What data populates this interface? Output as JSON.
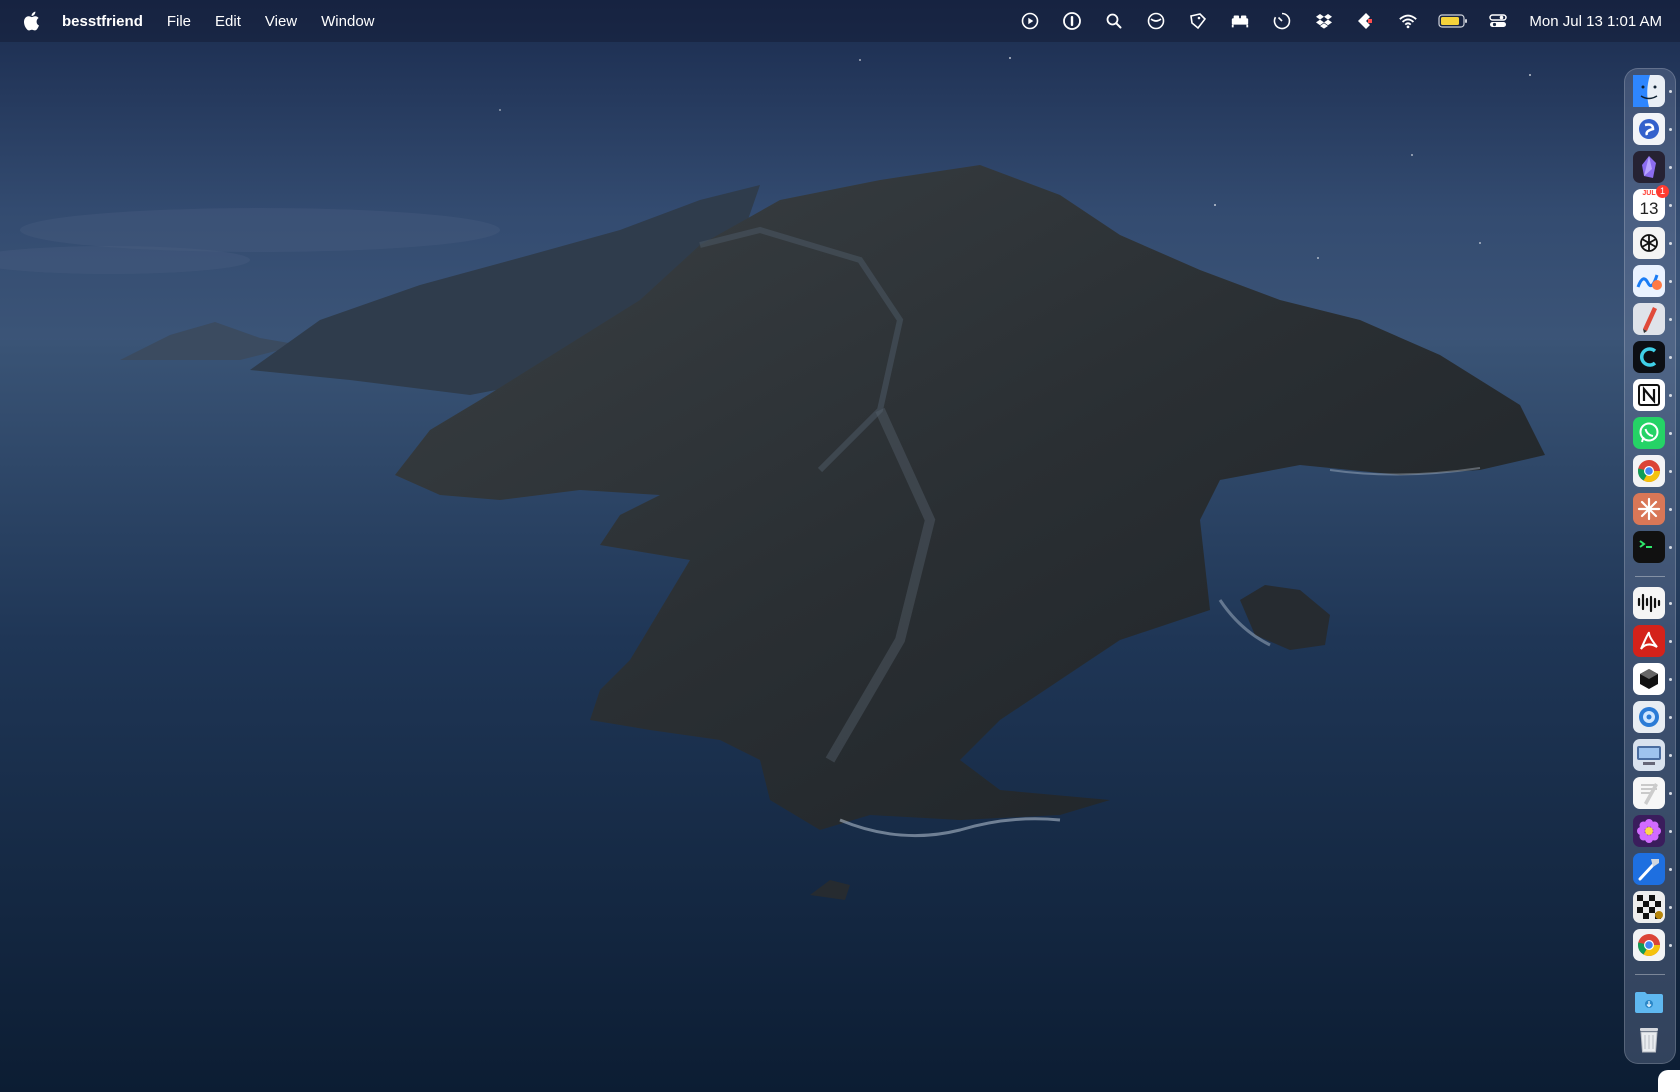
{
  "menubar": {
    "app_name": "besstfriend",
    "menus": [
      "File",
      "Edit",
      "View",
      "Window"
    ],
    "status_icons": [
      "play-circle-icon",
      "info-circle-icon",
      "search-icon",
      "do-not-disturb-icon",
      "shield-tag-icon",
      "bed-icon",
      "timer-icon",
      "dropbox-icon",
      "figma-icon",
      "wifi-icon",
      "battery-icon",
      "control-center-icon"
    ],
    "clock": "Mon Jul 13  1:01 AM"
  },
  "dock": {
    "apps": [
      {
        "name": "Finder",
        "icon": "finder-icon"
      },
      {
        "name": "Simplenote",
        "icon": "simplenote-icon"
      },
      {
        "name": "Obsidian",
        "icon": "obsidian-icon"
      },
      {
        "name": "Calendar",
        "icon": "calendar-icon",
        "month": "JUL",
        "day": "13",
        "badge": "1"
      },
      {
        "name": "ChatGPT",
        "icon": "chatgpt-icon"
      },
      {
        "name": "Freeform",
        "icon": "freeform-icon"
      },
      {
        "name": "Pencil App",
        "icon": "pencil-app-icon"
      },
      {
        "name": "Cursor Arc",
        "icon": "arc-icon"
      },
      {
        "name": "Notion",
        "icon": "notion-icon"
      },
      {
        "name": "WhatsApp",
        "icon": "whatsapp-icon"
      },
      {
        "name": "Chrome",
        "icon": "chrome-icon"
      },
      {
        "name": "Claude",
        "icon": "claude-icon"
      },
      {
        "name": "Terminal",
        "icon": "terminal-icon"
      },
      {
        "name": "Waveform",
        "icon": "waveform-icon"
      },
      {
        "name": "Acrobat",
        "icon": "acrobat-icon"
      },
      {
        "name": "Cube App",
        "icon": "cube-icon"
      },
      {
        "name": "Proxyman",
        "icon": "proxyman-icon"
      },
      {
        "name": "Screens",
        "icon": "screens-icon"
      },
      {
        "name": "TextEdit",
        "icon": "textedit-icon"
      },
      {
        "name": "Flower App",
        "icon": "flower-icon"
      },
      {
        "name": "Xcode",
        "icon": "xcode-icon"
      },
      {
        "name": "Chess",
        "icon": "chess-icon"
      },
      {
        "name": "Chrome Canary",
        "icon": "chrome-icon"
      },
      {
        "name": "Downloads",
        "icon": "downloads-folder-icon"
      },
      {
        "name": "Trash",
        "icon": "trash-icon"
      }
    ]
  }
}
